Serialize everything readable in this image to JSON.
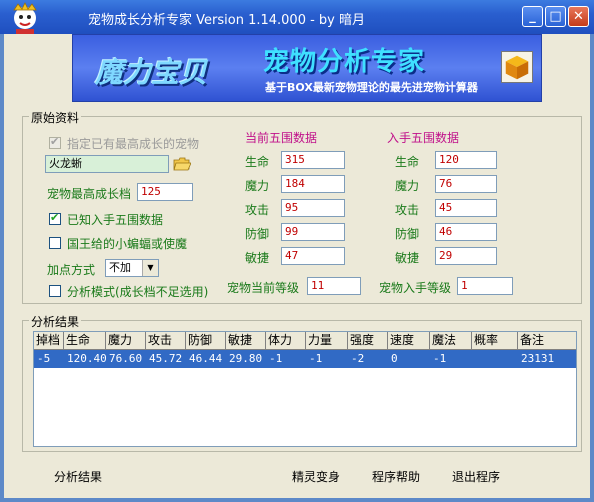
{
  "window": {
    "title": "宠物成长分析专家 Version 1.14.000 - by 暗月",
    "minimize_label": "_",
    "maximize_label": "□",
    "close_label": "✕"
  },
  "banner": {
    "logo": "魔力宝贝",
    "title": "宠物分析专家",
    "subtitle": "基于BOX最新宠物理论的最先进宠物计算器"
  },
  "raw": {
    "legend": "原始资料",
    "specify_label": "指定已有最高成长的宠物",
    "pet_name": "火龙蜥",
    "max_growth_label": "宠物最高成长档",
    "max_growth_value": "125",
    "known_stats_label": "已知入手五围数据",
    "king_bat_label": "国王给的小蝙蝠或使魔",
    "add_point_label": "加点方式",
    "add_point_value": "不加",
    "analysis_mode_label": "分析模式(成长档不足选用)"
  },
  "current": {
    "header": "当前五围数据",
    "hp_label": "生命",
    "hp": "315",
    "mp_label": "魔力",
    "mp": "184",
    "atk_label": "攻击",
    "atk": "95",
    "def_label": "防御",
    "def": "99",
    "agi_label": "敏捷",
    "agi": "47",
    "level_label": "宠物当前等级",
    "level": "11"
  },
  "initial": {
    "header": "入手五围数据",
    "hp_label": "生命",
    "hp": "120",
    "mp_label": "魔力",
    "mp": "76",
    "atk_label": "攻击",
    "atk": "45",
    "def_label": "防御",
    "def": "46",
    "agi_label": "敏捷",
    "agi": "29",
    "level_label": "宠物入手等级",
    "level": "1"
  },
  "results": {
    "legend": "分析结果",
    "columns": [
      "掉档",
      "生命",
      "魔力",
      "攻击",
      "防御",
      "敏捷",
      "体力",
      "力量",
      "强度",
      "速度",
      "魔法",
      "概率",
      "备注"
    ],
    "row": [
      "-5",
      "120.40",
      "76.60",
      "45.72",
      "46.44",
      "29.80",
      "-1",
      "-1",
      "-2",
      "0",
      "-1",
      "",
      "23131"
    ]
  },
  "footer": {
    "analyze": "分析结果",
    "spirit": "精灵变身",
    "help": "程序帮助",
    "exit": "退出程序"
  }
}
